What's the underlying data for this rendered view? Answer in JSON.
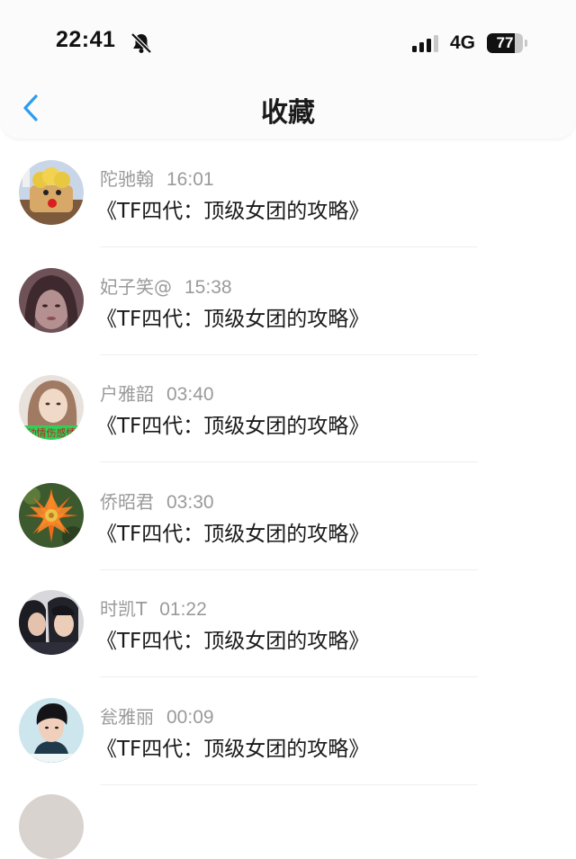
{
  "status_bar": {
    "time": "22:41",
    "network": "4G",
    "battery": "77",
    "battery_level": 0.77
  },
  "nav": {
    "title": "收藏"
  },
  "favorites": [
    {
      "name": "陀驰翰",
      "time": "16:01",
      "title": "《TF四代：顶级女团的攻略》"
    },
    {
      "name": "妃子笑@",
      "time": "15:38",
      "title": "《TF四代：顶级女团的攻略》"
    },
    {
      "name": "户雅韶",
      "time": "03:40",
      "title": "《TF四代：顶级女团的攻略》"
    },
    {
      "name": "侨昭君",
      "time": "03:30",
      "title": "《TF四代：顶级女团的攻略》"
    },
    {
      "name": "时凯T",
      "time": "01:22",
      "title": "《TF四代：顶级女团的攻略》"
    },
    {
      "name": "瓮雅丽",
      "time": "00:09",
      "title": "《TF四代：顶级女团的攻略》"
    }
  ],
  "avatar_images": {
    "third_banner_text": "动情伤感情"
  }
}
